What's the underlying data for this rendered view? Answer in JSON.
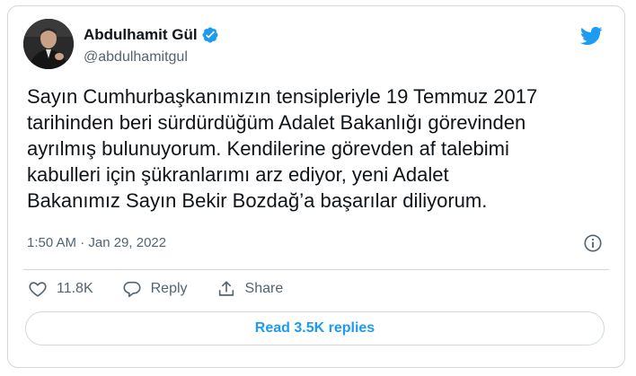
{
  "author": {
    "name": "Abdulhamit Gül",
    "handle": "@abdulhamitgul",
    "verified": true
  },
  "tweet": {
    "text": "Sayın Cumhurbaşkanımızın tensipleriyle 19 Temmuz 2017\ntarihinden beri sürdürdüğüm Adalet Bakanlığı görevinden\nayrılmış bulunuyorum. Kendilerine görevden af talebimi\nkabulleri için şükranlarımı arz ediyor, yeni Adalet\nBakanımız Sayın Bekir Bozdağ’a başarılar diliyorum.",
    "timestamp": "1:50 AM · Jan 29, 2022"
  },
  "actions": {
    "likes": "11.8K",
    "reply_label": "Reply",
    "share_label": "Share"
  },
  "replies_button": "Read 3.5K replies",
  "icons": {
    "verified": "verified-badge-icon",
    "brand": "twitter-bird-icon",
    "info": "info-icon",
    "like": "heart-icon",
    "reply": "reply-icon",
    "share": "share-icon"
  },
  "colors": {
    "accent": "#1d9bf0",
    "text": "#0f1419",
    "muted": "#536471",
    "border": "#cfd9de"
  }
}
